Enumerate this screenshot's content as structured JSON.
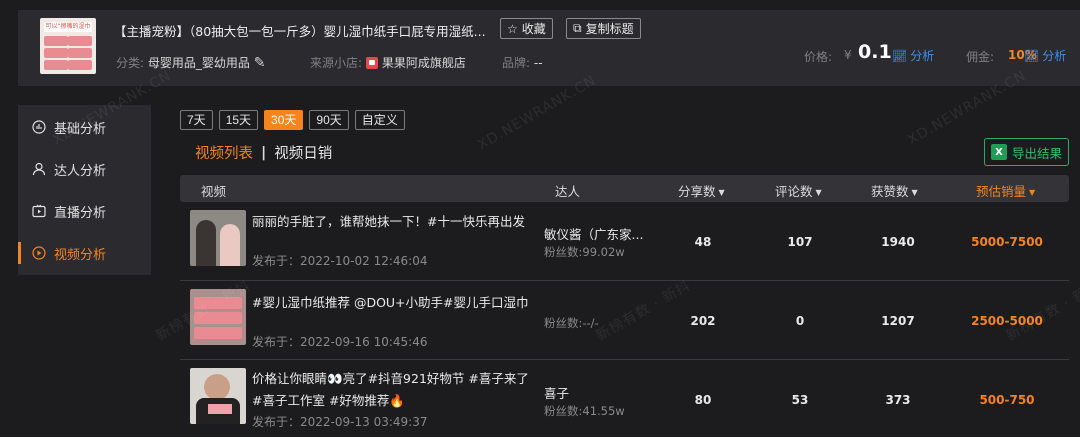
{
  "product": {
    "title": "【主播宠粉】（80抽大包一包一斤多）婴儿湿巾纸手口屁专用湿纸...",
    "thumb_banner": "可以“擦嘴的湿巾",
    "favorite_label": "收藏",
    "copy_title_label": "复制标题",
    "category_label": "分类:",
    "category_value": "母婴用品_婴幼用品",
    "store_label": "来源小店:",
    "store_value": "果果阿成旗舰店",
    "brand_label": "品牌:",
    "brand_value": "--",
    "price_label": "价格:",
    "price_currency": "¥",
    "price_value": "0.1",
    "analysis_label": "分析",
    "commission_label": "佣金:",
    "commission_value": "10%",
    "commission_analysis_label": "分析"
  },
  "sidebar": {
    "items": [
      {
        "label": "基础分析",
        "icon": "chart-circle-icon"
      },
      {
        "label": "达人分析",
        "icon": "user-icon"
      },
      {
        "label": "直播分析",
        "icon": "tv-play-icon"
      },
      {
        "label": "视频分析",
        "icon": "play-circle-icon"
      }
    ],
    "active_index": 3
  },
  "ranges": [
    "7天",
    "15天",
    "30天",
    "90天",
    "自定义"
  ],
  "active_range": "30天",
  "subtabs": {
    "video_list": "视频列表",
    "separator": "|",
    "video_daily_sales": "视频日销"
  },
  "export_label": "导出结果",
  "export_icon_text": "X",
  "table": {
    "headers": {
      "video": "视频",
      "talent": "达人",
      "shares": "分享数",
      "comments": "评论数",
      "likes": "获赞数",
      "est_sales": "预估销量"
    },
    "sort_caret": "▼",
    "rows": [
      {
        "title": "丽丽的手脏了，谁帮她抹一下！#十一快乐再出发",
        "title2": "",
        "date_label": "发布于：",
        "date": "2022-10-02 12:46:04",
        "talent": "敏仪酱（广东家...",
        "fans": "粉丝数:99.02w",
        "shares": "48",
        "comments": "107",
        "likes": "1940",
        "est_sales": "5000-7500"
      },
      {
        "title": "#婴儿湿巾纸推荐 @DOU+小助手#婴儿手口湿巾",
        "title2": "",
        "date_label": "发布于：",
        "date": "2022-09-16 10:45:46",
        "talent": "",
        "fans": "粉丝数:--/-",
        "shares": "202",
        "comments": "0",
        "likes": "1207",
        "est_sales": "2500-5000"
      },
      {
        "title": "价格让你眼睛👀亮了#抖音921好物节 #喜子来了",
        "title2": "#喜子工作室 #好物推荐🔥",
        "date_label": "发布于：",
        "date": "2022-09-13 03:49:37",
        "talent": "喜子",
        "fans": "粉丝数:41.55w",
        "shares": "80",
        "comments": "53",
        "likes": "373",
        "est_sales": "500-750"
      }
    ]
  },
  "watermarks": [
    "XD.NEWRANK.CN",
    "XD.NEWRANK.CN",
    "XD.NEWRANK.CN",
    "新榜有数 · 新抖",
    "新榜有数 · 新抖",
    "新榜有数 · 新抖"
  ],
  "colors": {
    "accent": "#f5841f",
    "link": "#3d8ef0",
    "export": "#2fbf6a",
    "bg": "#1c1c1f",
    "panel": "#2b2b2f"
  }
}
